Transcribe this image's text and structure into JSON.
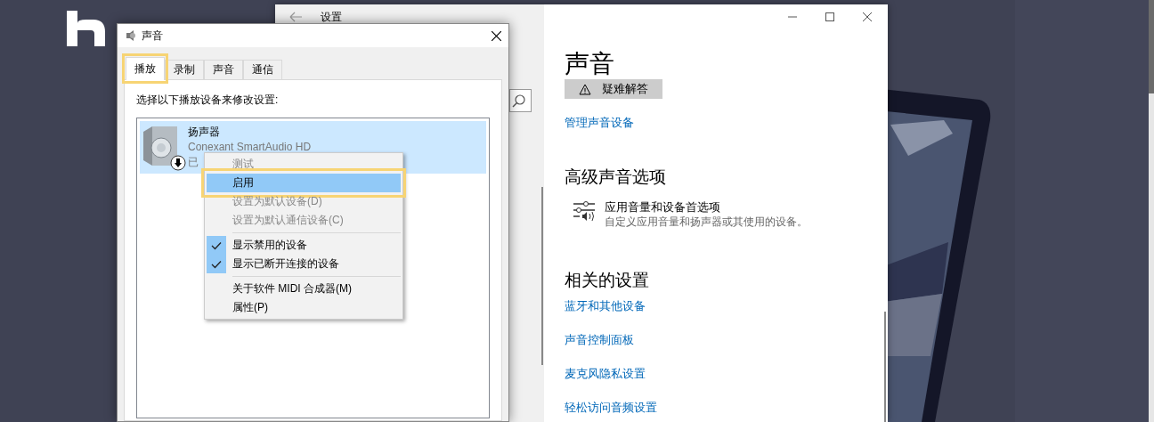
{
  "settings_window": {
    "title": "设置",
    "page_title": "声音",
    "troubleshoot_button": "疑难解答",
    "manage_link": "管理声音设备",
    "advanced": {
      "heading": "高级声音选项",
      "item": {
        "title": "应用音量和设备首选项",
        "description": "自定义应用音量和扬声器或其使用的设备。"
      }
    },
    "related": {
      "heading": "相关的设置",
      "links": [
        "蓝牙和其他设备",
        "声音控制面板",
        "麦克风隐私设置",
        "轻松访问音频设置"
      ]
    }
  },
  "sound_dialog": {
    "title": "声音",
    "tabs": [
      {
        "label": "播放",
        "selected": true,
        "highlighted": true
      },
      {
        "label": "录制",
        "selected": false,
        "highlighted": false
      },
      {
        "label": "声音",
        "selected": false,
        "highlighted": false
      },
      {
        "label": "通信",
        "selected": false,
        "highlighted": false
      }
    ],
    "instruction": "选择以下播放设备来修改设置:",
    "devices": [
      {
        "name": "扬声器",
        "driver": "Conexant SmartAudio HD",
        "status": "已",
        "selected": true,
        "disabled": true
      }
    ],
    "context_menu": {
      "items": [
        {
          "kind": "item",
          "label": "测试",
          "disabled": true,
          "checked": false,
          "selected": false,
          "highlighted": false
        },
        {
          "kind": "item",
          "label": "启用",
          "disabled": false,
          "checked": false,
          "selected": true,
          "highlighted": true
        },
        {
          "kind": "item",
          "label": "设置为默认设备(D)",
          "disabled": true,
          "checked": false,
          "selected": false,
          "highlighted": false
        },
        {
          "kind": "item",
          "label": "设置为默认通信设备(C)",
          "disabled": true,
          "checked": false,
          "selected": false,
          "highlighted": false
        },
        {
          "kind": "separator"
        },
        {
          "kind": "item",
          "label": "显示禁用的设备",
          "disabled": false,
          "checked": true,
          "selected": false,
          "highlighted": false
        },
        {
          "kind": "item",
          "label": "显示已断开连接的设备",
          "disabled": false,
          "checked": true,
          "selected": false,
          "highlighted": false
        },
        {
          "kind": "separator"
        },
        {
          "kind": "item",
          "label": "关于软件 MIDI 合成器(M)",
          "disabled": false,
          "checked": false,
          "selected": false,
          "highlighted": false
        },
        {
          "kind": "item",
          "label": "属性(P)",
          "disabled": false,
          "checked": false,
          "selected": false,
          "highlighted": false
        }
      ]
    }
  }
}
